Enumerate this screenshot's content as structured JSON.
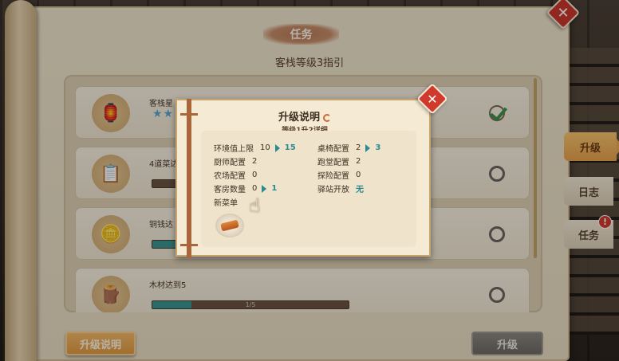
{
  "window": {
    "title": "任务",
    "subtitle": "客栈等级3指引"
  },
  "tasks": [
    {
      "name": "客栈星",
      "icon": "lantern-icon",
      "stars": "★★",
      "status": "completed"
    },
    {
      "name": "4道菜达",
      "icon": "menu-board-icon",
      "progress_text": "",
      "progress": 0.0,
      "status": "incomplete"
    },
    {
      "name": "铜钱达",
      "icon": "coin-icon",
      "progress_text": "",
      "progress": 0.2,
      "status": "incomplete"
    },
    {
      "name": "木材达到5",
      "icon": "wood-log-icon",
      "progress_text": "1/5",
      "progress": 0.2,
      "status": "incomplete"
    }
  ],
  "footer": {
    "explain_label": "升级说明",
    "upgrade_label": "升级"
  },
  "side_tabs": [
    {
      "label": "升级",
      "active": true
    },
    {
      "label": "日志",
      "active": false
    },
    {
      "label": "任务",
      "active": false,
      "badge": "!"
    }
  ],
  "modal": {
    "title": "升级说明",
    "subtitle": "等级1升2详细",
    "stats_left": [
      {
        "label": "环境值上限",
        "value": "10",
        "new_value": "15"
      },
      {
        "label": "厨师配置",
        "value": "2"
      },
      {
        "label": "农场配置",
        "value": "0"
      },
      {
        "label": "客房数量",
        "value": "0",
        "new_value": "1"
      }
    ],
    "stats_right": [
      {
        "label": "桌椅配置",
        "value": "2",
        "new_value": "3"
      },
      {
        "label": "跑堂配置",
        "value": "2"
      },
      {
        "label": "探险配置",
        "value": "0"
      },
      {
        "label": "驿站开放",
        "value": "无"
      }
    ],
    "menu_label": "新菜单",
    "menu_item_icon": "roasted-dish-icon"
  },
  "colors": {
    "accent": "#2a8a93",
    "close_red": "#cf3a2c",
    "progress_fill": "#3a9590",
    "tab_active": "#eba650"
  }
}
